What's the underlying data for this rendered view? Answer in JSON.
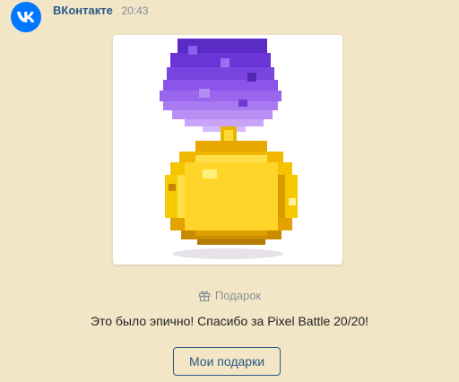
{
  "message": {
    "sender": "ВКонтакте",
    "time": "20:43",
    "avatar_icon": "vk-logo-icon",
    "avatar_color": "#0077ff"
  },
  "gift": {
    "image_icon": "pixel-medal-icon",
    "label_icon": "gift-icon",
    "label": "Подарок",
    "text": "Это было эпично! Спасибо за Pixel Battle 20/20!",
    "button_label": "Мои подарки"
  },
  "colors": {
    "background": "#f2e6c7",
    "link": "#2a5885",
    "muted": "#8b9198"
  }
}
